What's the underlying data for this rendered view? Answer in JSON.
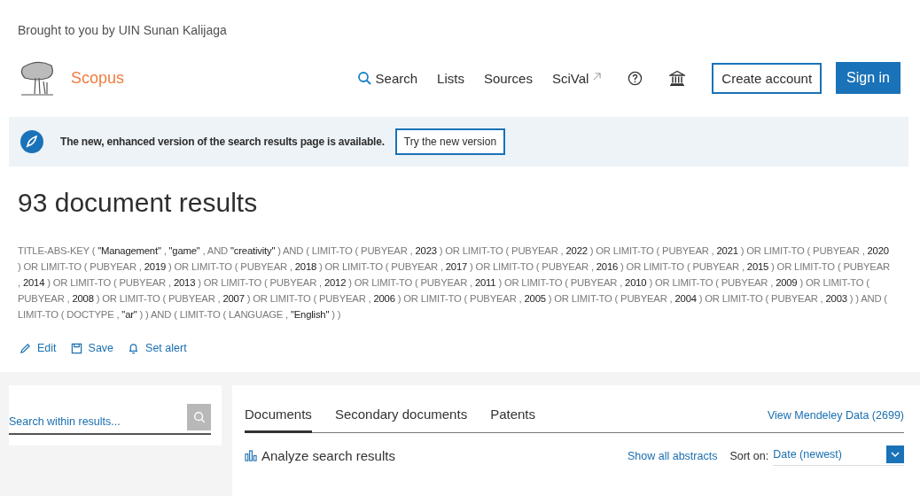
{
  "branding": "Brought to you by UIN Sunan Kalijaga",
  "header": {
    "logo_text": "Scopus",
    "nav": [
      {
        "label": "Search",
        "kind": "search"
      },
      {
        "label": "Lists",
        "kind": "plain"
      },
      {
        "label": "Sources",
        "kind": "plain"
      },
      {
        "label": "SciVal",
        "kind": "external"
      }
    ],
    "create_account": "Create account",
    "sign_in": "Sign in"
  },
  "banner": {
    "message": "The new, enhanced version of the search results page is available.",
    "button": "Try the new version"
  },
  "results_title": "93 document results",
  "query": "TITLE-ABS-KEY ( **\"Management\"** , **\"game\"** , AND **\"creativity\"** ) AND ( LIMIT-TO ( PUBYEAR , **2023** ) OR LIMIT-TO ( PUBYEAR , **2022** ) OR LIMIT-TO ( PUBYEAR , **2021** ) OR LIMIT-TO ( PUBYEAR , **2020** ) OR LIMIT-TO ( PUBYEAR , **2019** ) OR LIMIT-TO ( PUBYEAR , **2018** ) OR LIMIT-TO ( PUBYEAR , **2017** ) OR LIMIT-TO ( PUBYEAR , **2016** ) OR LIMIT-TO ( PUBYEAR , **2015** ) OR LIMIT-TO ( PUBYEAR , **2014** ) OR LIMIT-TO ( PUBYEAR , **2013** ) OR LIMIT-TO ( PUBYEAR , **2012** ) OR LIMIT-TO ( PUBYEAR , **2011** ) OR LIMIT-TO ( PUBYEAR , **2010** ) OR LIMIT-TO ( PUBYEAR , **2009** ) OR LIMIT-TO ( PUBYEAR , **2008** ) OR LIMIT-TO ( PUBYEAR , **2007** ) OR LIMIT-TO ( PUBYEAR , **2006** ) OR LIMIT-TO ( PUBYEAR , **2005** ) OR LIMIT-TO ( PUBYEAR , **2004** ) OR LIMIT-TO ( PUBYEAR , **2003** ) ) AND ( LIMIT-TO ( DOCTYPE , **\"ar\"** ) ) AND ( LIMIT-TO ( LANGUAGE , **\"English\"** ) )",
  "actions": [
    {
      "label": "Edit",
      "kind": "edit"
    },
    {
      "label": "Save",
      "kind": "save"
    },
    {
      "label": "Set alert",
      "kind": "alert"
    }
  ],
  "sidebar": {
    "search": {
      "placeholder": "Search within results..."
    }
  },
  "tabs": [
    {
      "label": "Documents",
      "selected": true
    },
    {
      "label": "Secondary documents",
      "selected": false
    },
    {
      "label": "Patents",
      "selected": false
    }
  ],
  "mendeley_link": "View Mendeley Data (2699)",
  "toolbar": {
    "analyze": "Analyze search results",
    "show_abstracts": "Show all abstracts",
    "sort_label": "Sort on:",
    "sort_value": "Date (newest)"
  }
}
